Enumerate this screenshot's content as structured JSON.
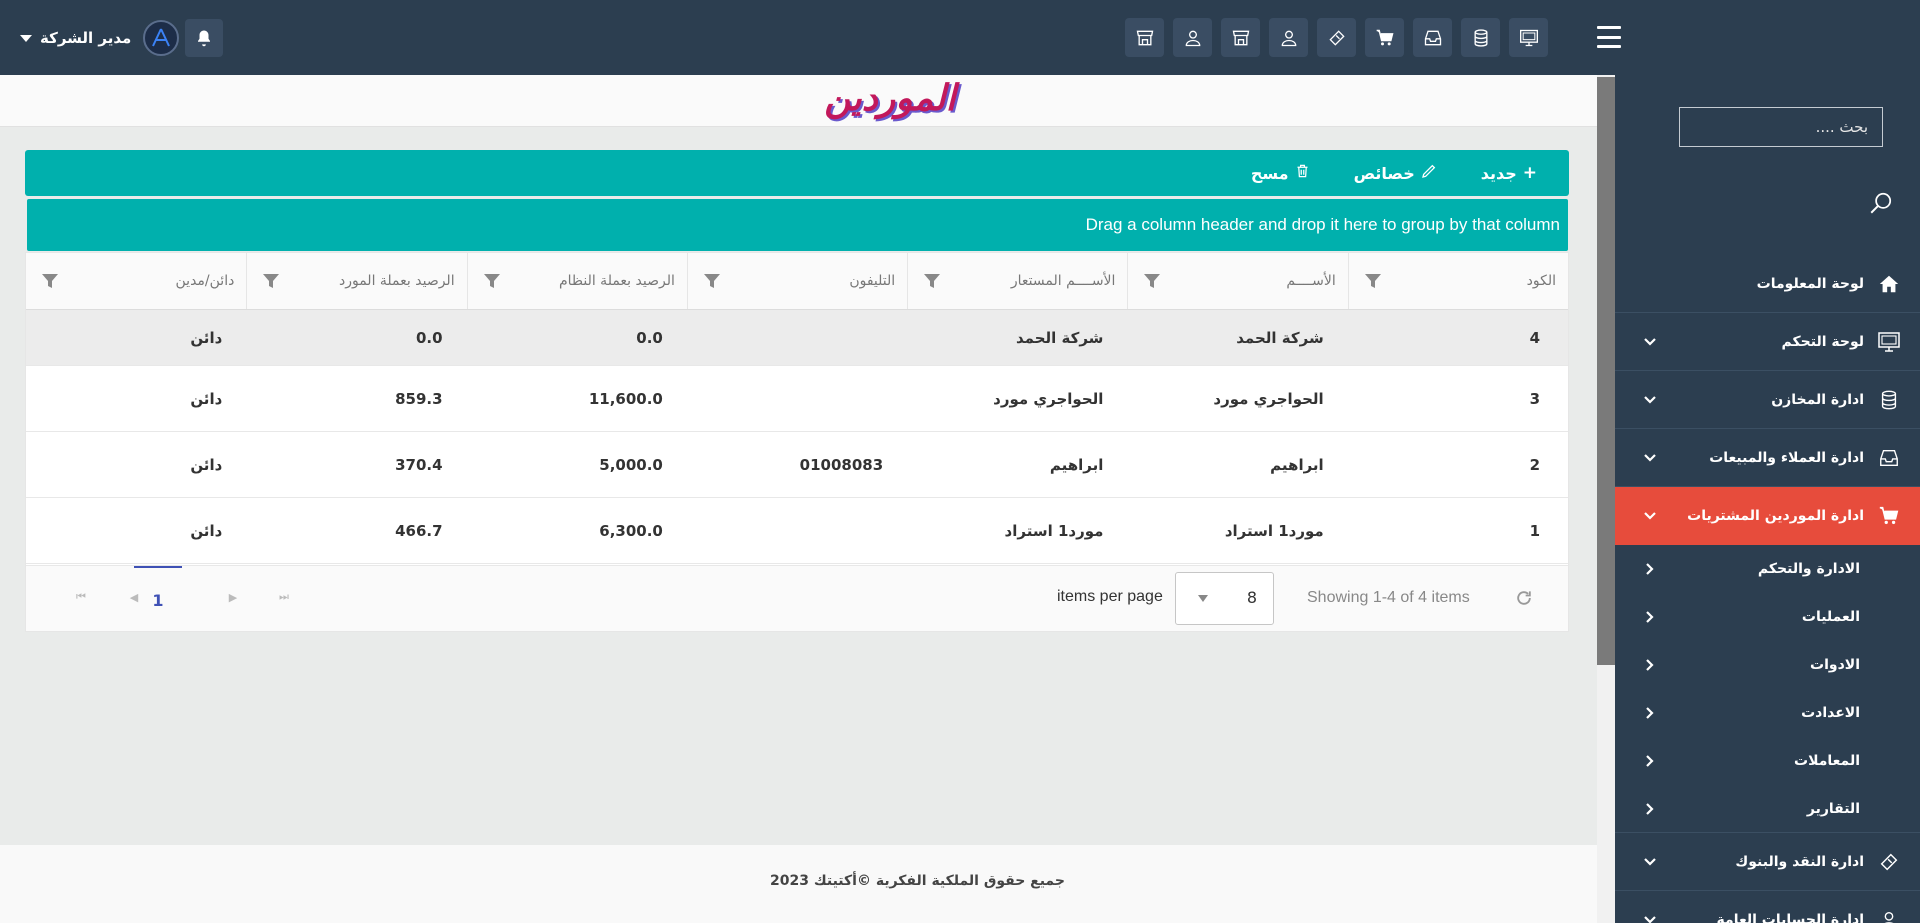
{
  "topbar": {
    "user_name": "مدير الشركة",
    "toolbar_icons": [
      "monitor-icon",
      "database-icon",
      "inbox-icon",
      "cart-icon",
      "money-icon",
      "user-icon",
      "store-icon",
      "user-icon",
      "store-icon"
    ]
  },
  "sidebar": {
    "search_placeholder": "بحث ....",
    "items": [
      {
        "label": "لوحة المعلومات",
        "icon": "home-icon"
      },
      {
        "label": "لوحة التحكم",
        "icon": "monitor-icon"
      },
      {
        "label": "ادارة المخازن",
        "icon": "database-icon"
      },
      {
        "label": "ادارة العملاء والمبيعات",
        "icon": "inbox-icon"
      },
      {
        "label": "ادارة الموردين المشتريات",
        "icon": "cart-icon"
      },
      {
        "label": "ادارة النقد والبنوك",
        "icon": "money-icon"
      },
      {
        "label": "ادارة الحسابات العامة",
        "icon": "user-icon"
      }
    ],
    "sub_items": [
      {
        "label": "الادارة والتحكم"
      },
      {
        "label": "العمليات"
      },
      {
        "label": "الادوات"
      },
      {
        "label": "الاعدادت"
      },
      {
        "label": "المعاملات"
      },
      {
        "label": "التقارير"
      }
    ]
  },
  "page": {
    "title": "الموردين",
    "toolbar": {
      "new_label": "جديد",
      "properties_label": "خصائص",
      "delete_label": "مسح"
    },
    "group_hint": "Drag a column header and drop it here to group by that column"
  },
  "grid": {
    "headers": [
      "الكود",
      "الأســــم",
      "الأســــم المستعار",
      "التليفون",
      "الرصيد بعملة النظام",
      "الرصيد بعملة المورد",
      "دائن/مدين"
    ],
    "rows": [
      [
        "4",
        "شركة الحمد",
        "شركة الحمد",
        "",
        "0.0",
        "0.0",
        "دائن"
      ],
      [
        "3",
        "الحواجري مورد",
        "الحواجري مورد",
        "",
        "11,600.0",
        "859.3",
        "دائن"
      ],
      [
        "2",
        "ابراهيم",
        "ابراهيم",
        "01008083",
        "5,000.0",
        "370.4",
        "دائن"
      ],
      [
        "1",
        "مورد1 استراد",
        "مورد1 استراد",
        "",
        "6,300.0",
        "466.7",
        "دائن"
      ]
    ]
  },
  "pager": {
    "current_page": "1",
    "page_size": "8",
    "per_page_label": "items per page",
    "info": "Showing 1-4 of 4 items"
  },
  "footer": {
    "text": "جميع حقوق الملكية الفكرية ©أكتيتك 2023"
  },
  "colors": {
    "topbar": "#2c3e50",
    "accent_teal": "#00b0ad",
    "active_menu": "#e74c3c",
    "title_pink": "#c2185b"
  }
}
